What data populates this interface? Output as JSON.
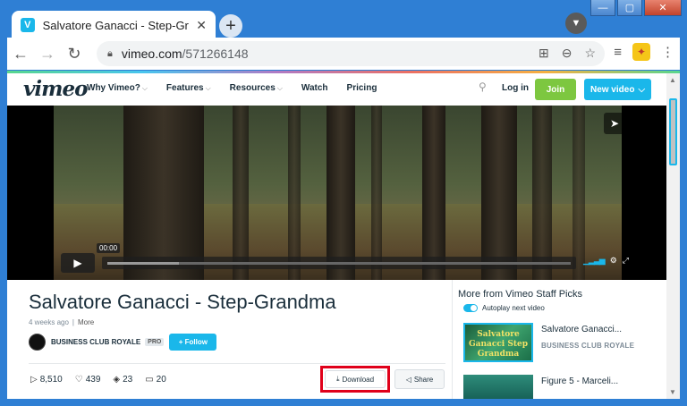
{
  "browser": {
    "tab_title": "Salvatore Ganacci - Step-Gran",
    "tab_favicon": "V",
    "new_tab_symbol": "+",
    "url_host": "vimeo.com",
    "url_path": "/571266148",
    "icons": [
      "back-icon",
      "forward-icon",
      "reload-icon",
      "lock-icon",
      "translate-icon",
      "zoom-icon",
      "star-icon",
      "media-icon",
      "extension-icon",
      "menu-icon"
    ]
  },
  "vimeo_nav": {
    "logo": "vimeo",
    "links": [
      "Why Vimeo?",
      "Features",
      "Resources",
      "Watch",
      "Pricing"
    ],
    "login": "Log in",
    "join": "Join",
    "new_video": "New video"
  },
  "player": {
    "timecode": "00:00",
    "progress_loaded_fraction": 0.15
  },
  "video": {
    "title": "Salvatore Ganacci - Step-Grandma",
    "age": "4 weeks ago",
    "more": "More",
    "owner": "BUSINESS CLUB ROYALE",
    "owner_badge": "PRO",
    "follow": "+ Follow",
    "plays": "8,510",
    "likes": "439",
    "collections": "23",
    "comments": "20",
    "download": "Download",
    "share": "Share"
  },
  "sidebar": {
    "title": "More from Vimeo Staff Picks",
    "autoplay_label": "Autoplay next video",
    "autoplay_on": true,
    "recs": [
      {
        "thumb_text": "Salvatore Ganacci Step Grandma",
        "title": "Salvatore Ganacci...",
        "owner": "BUSINESS CLUB ROYALE"
      },
      {
        "thumb_text": "",
        "title": "Figure 5 - Marceli...",
        "owner": ""
      }
    ]
  },
  "colors": {
    "accent": "#1ab7ea",
    "join": "#7dc740",
    "highlight": "#e0001a"
  }
}
